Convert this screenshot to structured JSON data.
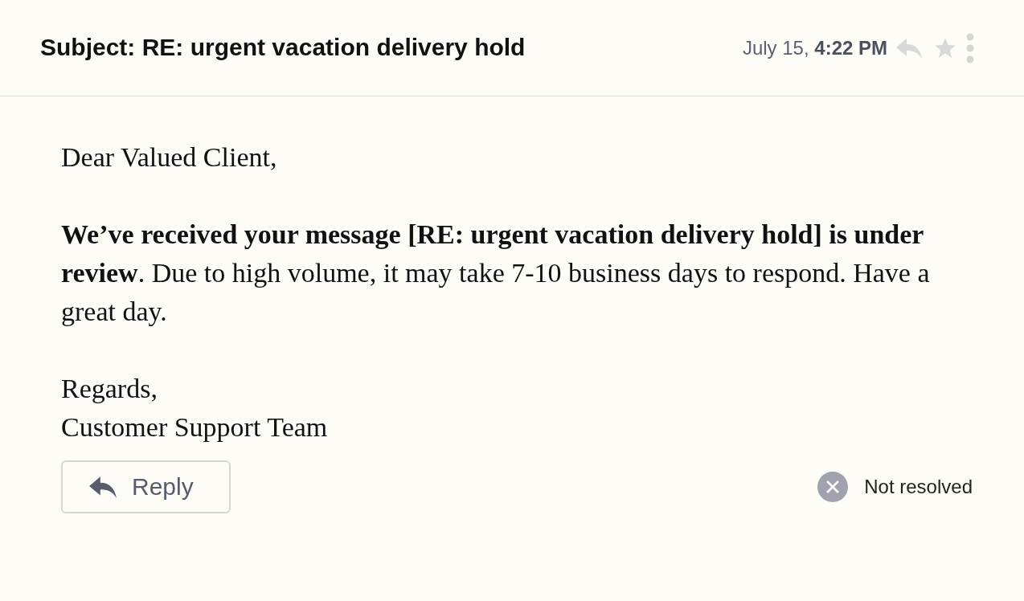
{
  "header": {
    "subject": "Subject: RE: urgent vacation delivery hold",
    "date": "July 15, **4:22 PM**",
    "starred": false
  },
  "body": {
    "greeting": "Dear Valued Client,",
    "paragraph": "**We’ve received your message [RE: urgent vacation delivery hold] is under review**. Due to high volume, it may take 7-10 business days to respond. Have a great day.",
    "closing": "Regards,",
    "signature": "Customer Support Team"
  },
  "reply_button": {
    "label": "Reply"
  },
  "status": {
    "label": "Not resolved",
    "resolved": false
  }
}
